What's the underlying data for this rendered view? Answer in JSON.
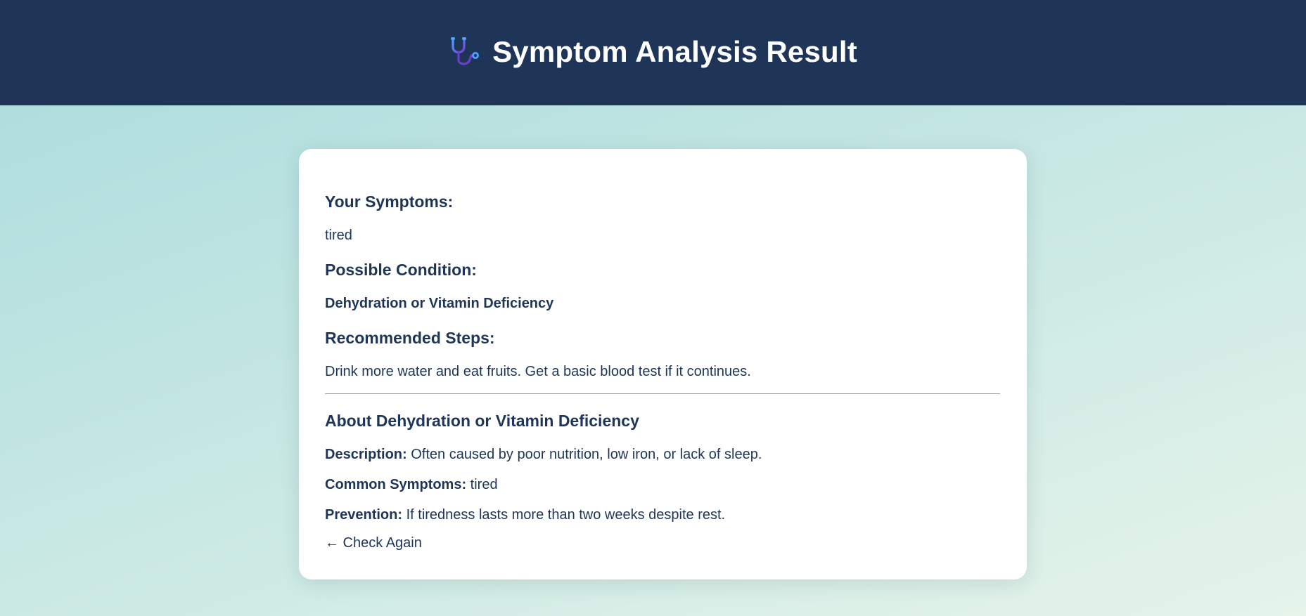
{
  "header": {
    "title": "Symptom Analysis Result",
    "icon": "stethoscope-icon",
    "background": "#1e3557"
  },
  "result": {
    "symptoms_heading": "Your Symptoms:",
    "symptoms_value": "tired",
    "condition_heading": "Possible Condition:",
    "condition_value": "Dehydration or Vitamin Deficiency",
    "steps_heading": "Recommended Steps:",
    "steps_value": "Drink more water and eat fruits. Get a basic blood test if it continues."
  },
  "about": {
    "heading": "About Dehydration or Vitamin Deficiency",
    "description_label": "Description:",
    "description_value": " Often caused by poor nutrition, low iron, or lack of sleep.",
    "common_symptoms_label": "Common Symptoms:",
    "common_symptoms_value": " tired",
    "prevention_label": "Prevention:",
    "prevention_value": " If tiredness lasts more than two weeks despite rest."
  },
  "back_link": {
    "label": "← Check Again"
  },
  "colors": {
    "text": "#1e3557",
    "card": "#ffffff",
    "divider": "#9aa0a6"
  }
}
